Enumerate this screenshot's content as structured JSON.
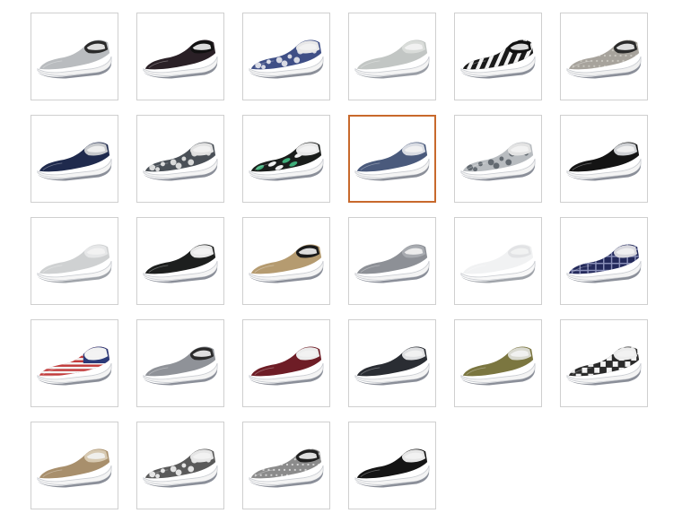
{
  "title": "",
  "selected_index": 9,
  "colors": {
    "selected_border": "#c8692c",
    "tile_border": "#cfcfcf"
  },
  "swatches": [
    {
      "upper": "#b9bcbf",
      "collar": "#2a2a2a",
      "pattern": "none",
      "accent": "#9a9da1",
      "sole": "#f2f2f2",
      "foxing": "#8b8f99"
    },
    {
      "upper": "#2a2026",
      "collar": "#111111",
      "pattern": "none",
      "accent": "#1a1418",
      "sole": "#f4f4f4",
      "foxing": "#8b8f99"
    },
    {
      "upper": "#3f4f86",
      "collar": "#e8e8e8",
      "pattern": "floral",
      "accent": "#e9e9ee",
      "sole": "#f4f4f4",
      "foxing": "#8b8f99"
    },
    {
      "upper": "#c2c6c4",
      "collar": "#d9dcd9",
      "pattern": "none",
      "accent": "#aeb2b0",
      "sole": "#f4f4f4",
      "foxing": "#9a9ea6"
    },
    {
      "upper": "#1a1a1a",
      "collar": "#111111",
      "pattern": "stripes",
      "accent": "#f2f2f2",
      "sole": "#f4f4f4",
      "foxing": "#8b8f99"
    },
    {
      "upper": "#a7a39c",
      "collar": "#2a2a2a",
      "pattern": "sparkle",
      "accent": "#d2cfc8",
      "sole": "#f0f0f0",
      "foxing": "#8b8f99"
    },
    {
      "upper": "#1f2a4d",
      "collar": "#c7c9cc",
      "pattern": "none",
      "accent": "#9a9ea5",
      "sole": "#f4f4f4",
      "foxing": "#8b8f99"
    },
    {
      "upper": "#4a5057",
      "collar": "#e2e2e2",
      "pattern": "floral",
      "accent": "#e8e8e8",
      "sole": "#f4f4f4",
      "foxing": "#8b8f99"
    },
    {
      "upper": "#1a1d1b",
      "collar": "#e8e8e8",
      "pattern": "tropical",
      "accent": "#3fae7a",
      "sole": "#f4f4f4",
      "foxing": "#8b8f99"
    },
    {
      "upper": "#4a5a7c",
      "collar": "#d9dce3",
      "pattern": "none",
      "accent": "#3d4a66",
      "sole": "#f4f4f4",
      "foxing": "#8b8f99"
    },
    {
      "upper": "#b8bcc0",
      "collar": "#e3e3e3",
      "pattern": "floral",
      "accent": "#5a6068",
      "sole": "#f4f4f4",
      "foxing": "#8b8f99"
    },
    {
      "upper": "#141414",
      "collar": "#cfd1d4",
      "pattern": "none",
      "accent": "#dcdcdc",
      "sole": "#f4f4f4",
      "foxing": "#8b8f99"
    },
    {
      "upper": "#cfd1d2",
      "collar": "#e6e7e8",
      "pattern": "none",
      "accent": "#b8babc",
      "sole": "#f6f6f6",
      "foxing": "#a0a4aa"
    },
    {
      "upper": "#1d1f1e",
      "collar": "#e8e8e8",
      "pattern": "none",
      "accent": "#333533",
      "sole": "#f4f4f4",
      "foxing": "#8b8f99"
    },
    {
      "upper": "#b59b70",
      "collar": "#1a1a1a",
      "pattern": "none",
      "accent": "#a58b62",
      "sole": "#f4f4f4",
      "foxing": "#8b8f99"
    },
    {
      "upper": "#8d9096",
      "collar": "#a8abb0",
      "pattern": "none",
      "accent": "#7d8086",
      "sole": "#f4f4f4",
      "foxing": "#8b8f99"
    },
    {
      "upper": "#f1f2f3",
      "collar": "#e2e3e5",
      "pattern": "none",
      "accent": "#dcdde0",
      "sole": "#f8f8f8",
      "foxing": "#a0a4aa"
    },
    {
      "upper": "#23295a",
      "collar": "#d8d8de",
      "pattern": "plaid",
      "accent": "#8a90b8",
      "sole": "#f4f4f4",
      "foxing": "#8b8f99"
    },
    {
      "upper": "#c23b3b",
      "collar": "#f2f2f2",
      "pattern": "flag",
      "accent": "#f4f4f4",
      "sole": "#f4f4f4",
      "foxing": "#8b8f99"
    },
    {
      "upper": "#8f9298",
      "collar": "#2a2a2a",
      "pattern": "none",
      "accent": "#7f8288",
      "sole": "#f4f4f4",
      "foxing": "#8b8f99"
    },
    {
      "upper": "#6e1d26",
      "collar": "#ececec",
      "pattern": "none",
      "accent": "#5d1820",
      "sole": "#f4f4f4",
      "foxing": "#8b8f99"
    },
    {
      "upper": "#2a2d33",
      "collar": "#dfe0e2",
      "pattern": "none",
      "accent": "#3a3d43",
      "sole": "#f4f4f4",
      "foxing": "#8b8f99"
    },
    {
      "upper": "#7b7640",
      "collar": "#d9d9d0",
      "pattern": "none",
      "accent": "#6b6636",
      "sole": "#f4f4f4",
      "foxing": "#8b8f99"
    },
    {
      "upper": "#2a2a2a",
      "collar": "#ececec",
      "pattern": "checker",
      "accent": "#f2f2f2",
      "sole": "#f4f4f4",
      "foxing": "#8b8f99"
    },
    {
      "upper": "#a88f6c",
      "collar": "#d7c9b1",
      "pattern": "none",
      "accent": "#98805f",
      "sole": "#f4f4f4",
      "foxing": "#8b8f99"
    },
    {
      "upper": "#5a5a5a",
      "collar": "#e6e6e6",
      "pattern": "floral",
      "accent": "#f2f2f2",
      "sole": "#f4f4f4",
      "foxing": "#8b8f99"
    },
    {
      "upper": "#8b8b8b",
      "collar": "#1f1f1f",
      "pattern": "sparkle",
      "accent": "#e6e6e6",
      "sole": "#f4f4f4",
      "foxing": "#8b8f99"
    },
    {
      "upper": "#141414",
      "collar": "#e6e6e6",
      "pattern": "none",
      "accent": "#2b2b2b",
      "sole": "#f4f4f4",
      "foxing": "#8b8f99"
    }
  ]
}
